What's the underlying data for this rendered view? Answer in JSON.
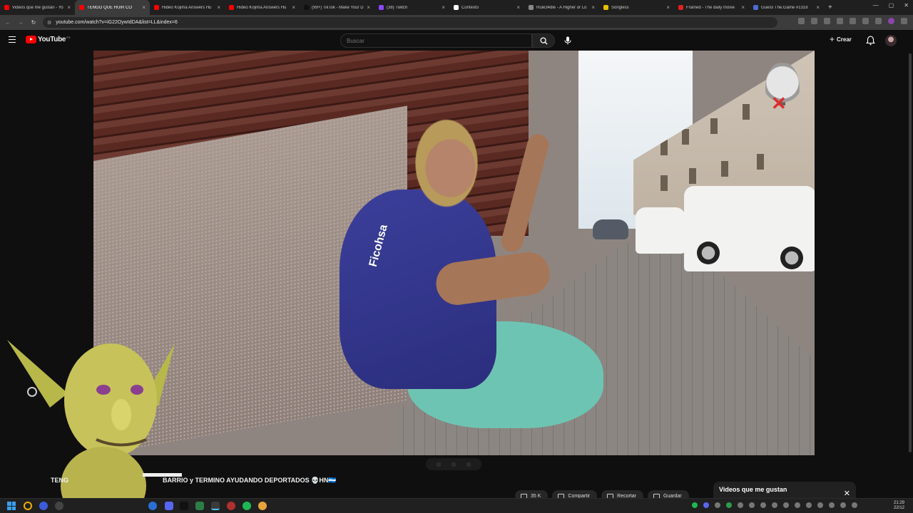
{
  "browser": {
    "tabs": [
      {
        "title": "Videos que me gustan - Yo",
        "color": "#ff0000",
        "active": false
      },
      {
        "title": "TENGO QUE HUIR CO",
        "color": "#ff0000",
        "active": true
      },
      {
        "title": "Hideo Kojima Answers Hu",
        "color": "#ff0000",
        "active": false
      },
      {
        "title": "Hideo Kojima Answers Hu",
        "color": "#ff0000",
        "active": false
      },
      {
        "title": "(99+) TikTok - Make Your D",
        "color": "#111111",
        "active": false
      },
      {
        "title": "(38) Twitch",
        "color": "#9146ff",
        "active": false
      },
      {
        "title": "Contexto",
        "color": "#ffffff",
        "active": false
      },
      {
        "title": "Rule34dle - A Higher or Lo",
        "color": "#888888",
        "active": false
      },
      {
        "title": "Songless",
        "color": "#e5c100",
        "active": false
      },
      {
        "title": "Framed - The daily movie",
        "color": "#e02020",
        "active": false
      },
      {
        "title": "Guess The.Game #1318",
        "color": "#4a6cd4",
        "active": false
      }
    ],
    "url": "youtube.com/watch?v=iG22OywIdDA&list=LL&index=6"
  },
  "youtube": {
    "logo_text": "YouTube",
    "country_code": "ES",
    "search_placeholder": "Buscar",
    "create_label": "Crear"
  },
  "video": {
    "sponsor_text": "Ficohsa",
    "title_start": "TENG",
    "title_end": "BARRIO y TERMINO AYUDANDO DEPORTADOS 💀HN🇭🇳",
    "actions": [
      {
        "label": "35 K"
      },
      {
        "label": "Compartir"
      },
      {
        "label": "Recortar"
      },
      {
        "label": "Guardar"
      }
    ]
  },
  "playlist": {
    "title": "Videos que me gustan"
  },
  "taskbar": {
    "time": "21:29",
    "date": "22/12"
  }
}
